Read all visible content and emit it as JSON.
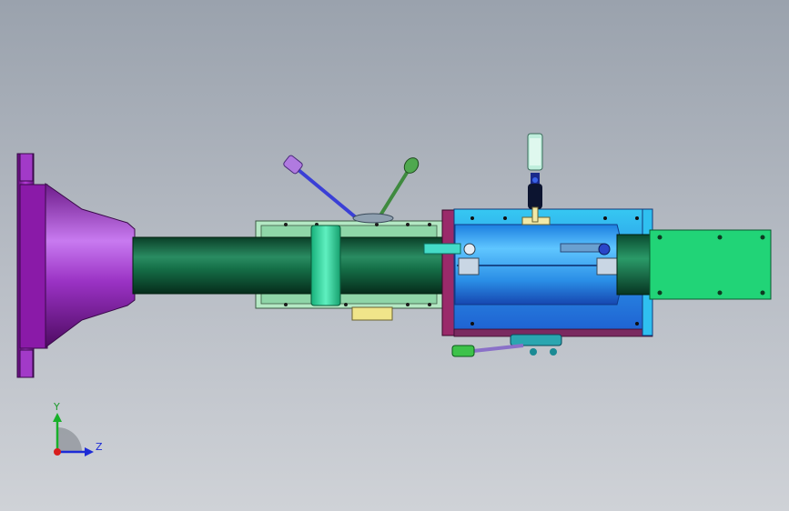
{
  "viewport": {
    "background_top": "#9aa2ad",
    "background_bottom": "#cfd2d7"
  },
  "model": {
    "parts": [
      "flange-icon",
      "tailstock-cone-icon",
      "spindle-shaft-icon",
      "headstock-housing-icon",
      "collar-ring-icon",
      "lever-handle-icon",
      "gearbox-housing-icon",
      "motor-block-icon",
      "control-knob-icon",
      "foot-lever-icon"
    ],
    "colors": {
      "flange": "#8a1aa8",
      "cone": "#9b2fc4",
      "shaft": "#0f5e3c",
      "headstock": "#8ed8a6",
      "collar": "#27d49a",
      "gearbox": "#2e96ea",
      "motor": "#21d477",
      "lever_blue": "#3a3fd6",
      "lever_green": "#3f8a3f",
      "handle_purple": "#b07ae0"
    }
  },
  "triad": {
    "y_label": "Y",
    "z_label": "Z",
    "colors": {
      "y": "#18b02a",
      "z": "#1d2bd6",
      "x": "#d81d1d"
    }
  }
}
